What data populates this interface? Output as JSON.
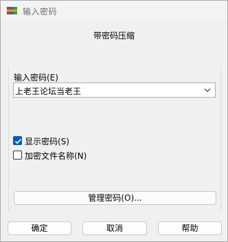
{
  "window": {
    "title": "输入密码"
  },
  "header": {
    "text": "带密码压缩"
  },
  "password": {
    "label": "输入密码(E)",
    "value": "上老王论坛当老王"
  },
  "options": {
    "show_password": {
      "label": "显示密码(S)",
      "checked": true
    },
    "encrypt_filenames": {
      "label": "加密文件名称(N)",
      "checked": false
    }
  },
  "buttons": {
    "manage": "管理密码(O)...",
    "ok": "确定",
    "cancel": "取消",
    "help": "帮助"
  },
  "colors": {
    "accent": "#005fb8"
  },
  "icons": {
    "app": "winrar-books-icon",
    "combo": "chevron-down-icon",
    "check": "checkmark-icon"
  }
}
